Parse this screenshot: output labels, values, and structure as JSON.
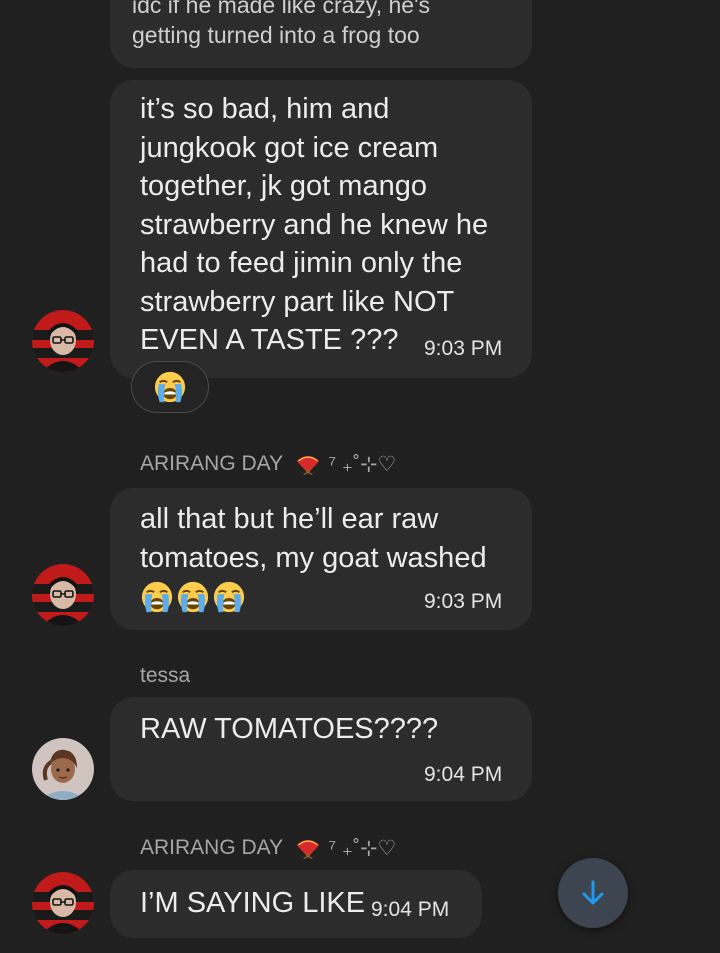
{
  "messages": [
    {
      "text": "idc if he made like crazy, he's\ngetting turned into a frog too"
    },
    {
      "text": "it’s so bad, him and\njungkook got ice cream\ntogether, jk got mango\nstrawberry and he knew he\nhad to feed jimin only the\nstrawberry part like NOT\nEVEN A TASTE ???",
      "time": "9:03 PM",
      "reaction": "loudly-crying-face"
    },
    {
      "sender": "ARIRANG DAY",
      "sender_suffix": "⁷ ₊˚⊹♡",
      "text": "all that but he’ll ear raw\ntomatoes, my goat washed",
      "emojis": [
        "loudly-crying-face",
        "loudly-crying-face",
        "loudly-crying-face"
      ],
      "time": "9:03 PM"
    },
    {
      "sender": "tessa",
      "text": "RAW TOMATOES????",
      "time": "9:04 PM"
    },
    {
      "sender": "ARIRANG DAY",
      "sender_suffix": "⁷ ₊˚⊹♡",
      "text": "I’M SAYING LIKE",
      "time": "9:04 PM"
    }
  ],
  "icons": {
    "sender_badge": "folding-fan-icon",
    "scroll_button": "arrow-down-icon",
    "reaction": "loudly-crying-face-icon"
  },
  "colors": {
    "background": "#202020",
    "bubble": "#2c2c2d",
    "accent": "#1d9bf0"
  }
}
